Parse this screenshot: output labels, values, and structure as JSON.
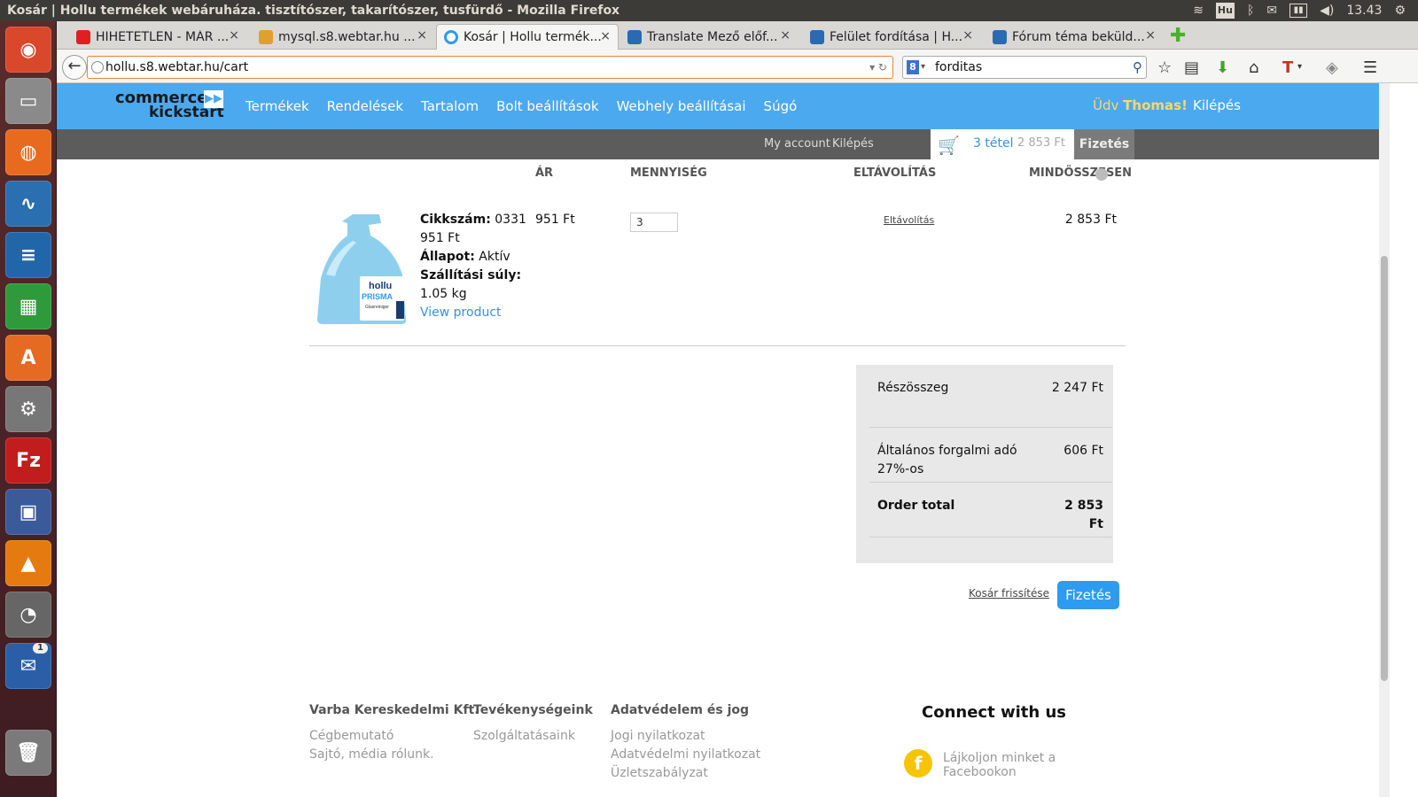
{
  "window": {
    "title": "Kosár | Hollu termékek webáruháza. tisztítószer, takarítószer, tusfürdő - Mozilla Firefox",
    "clock": "13.43",
    "keyboard": "Hu"
  },
  "tabs": [
    {
      "label": "HIHETETLEN - MÁR ...",
      "close": "×",
      "active": false,
      "fav_color": "#e02020"
    },
    {
      "label": "mysql.s8.webtar.hu ...",
      "close": "×",
      "active": false,
      "fav_color": "#e0a030"
    },
    {
      "label": "Kosár | Hollu termék...",
      "close": "×",
      "active": true,
      "fav_color": "#2d9bf0"
    },
    {
      "label": "Translate Mező előf...",
      "close": "×",
      "active": false,
      "fav_color": "#2a6ab0"
    },
    {
      "label": "Felület fordítása | H...",
      "close": "×",
      "active": false,
      "fav_color": "#2a6ab0"
    },
    {
      "label": "Fórum téma beküld...",
      "close": "×",
      "active": false,
      "fav_color": "#2a6ab0"
    }
  ],
  "navbar": {
    "url": "hollu.s8.webtar.hu/cart",
    "search_value": "forditas",
    "search_engine": "8"
  },
  "launcher": [
    {
      "name": "ubuntu-icon",
      "bg": "#d9482b",
      "glyph": "◉"
    },
    {
      "name": "files-icon",
      "bg": "#8a8a8a",
      "glyph": "▭"
    },
    {
      "name": "firefox-icon",
      "bg": "#e86a1f",
      "glyph": "◍"
    },
    {
      "name": "system-monitor-icon",
      "bg": "#2a6fb0",
      "glyph": "∿"
    },
    {
      "name": "writer-icon",
      "bg": "#2266aa",
      "glyph": "≡"
    },
    {
      "name": "calc-icon",
      "bg": "#2f9a3b",
      "glyph": "▦"
    },
    {
      "name": "software-center-icon",
      "bg": "#e56b22",
      "glyph": "A"
    },
    {
      "name": "settings-icon",
      "bg": "#777",
      "glyph": "⚙"
    },
    {
      "name": "filezilla-icon",
      "bg": "#c11d1d",
      "glyph": "Fz"
    },
    {
      "name": "screenshot-icon",
      "bg": "#3a5a9a",
      "glyph": "▣"
    },
    {
      "name": "vlc-icon",
      "bg": "#e57a10",
      "glyph": "▲"
    },
    {
      "name": "gimp-icon",
      "bg": "#666",
      "glyph": "◔"
    },
    {
      "name": "thunderbird-icon",
      "bg": "#2a5fa8",
      "glyph": "✉",
      "badge": "1"
    },
    {
      "name": "trash-icon",
      "bg": "#7a7a7a",
      "glyph": "🗑"
    }
  ],
  "site": {
    "logo_line1": "commerce",
    "logo_line2": "kickstart",
    "logo_arrow": "▶▶",
    "nav": [
      "Termékek",
      "Rendelések",
      "Tartalom",
      "Bolt beállítások",
      "Webhely beállításai",
      "Súgó"
    ],
    "greeting_prefix": "Üdv",
    "greeting_name": "Thomas!",
    "logout": "Kilépés",
    "my_account": "My account",
    "logout_small": "Kilépés",
    "cart_count": "3 tétel",
    "cart_amount": "2 853 Ft",
    "checkout_tab": "Fizetés"
  },
  "cart": {
    "headers": {
      "price": "ÁR",
      "quantity": "MENNYISÉG",
      "remove": "ELTÁVOLÍTÁS",
      "total": "MINDÖSSZESEN"
    },
    "item": {
      "sku_label": "Cikkszám:",
      "sku_value": "0331",
      "sku_price": "951 Ft",
      "status_label": "Állapot:",
      "status_value": "Aktív",
      "weight_label": "Szállítási súly:",
      "weight_value": "1.05 kg",
      "view_link": "View product",
      "price": "951 Ft",
      "quantity": "3",
      "remove": "Eltávolítás",
      "line_total": "2 853 Ft",
      "image_brand": "hollu",
      "image_product": "PRISMA",
      "image_sub": "Glasreiniger"
    },
    "summary": {
      "subtotal_label": "Részösszeg",
      "subtotal_value": "2 247 Ft",
      "vat_label": "Általános forgalmi adó 27%-os",
      "vat_value": "606 Ft",
      "total_label": "Order total",
      "total_value": "2 853 Ft"
    },
    "update_button": "Kosár frissítése",
    "checkout_button": "Fizetés"
  },
  "footer": {
    "col1": {
      "heading": "Varba Kereskedelmi Kft.",
      "links": [
        "Cégbemutató",
        "Sajtó, média rólunk."
      ]
    },
    "col2": {
      "heading": "Tevékenységeink",
      "links": [
        "Szolgáltatásaink"
      ]
    },
    "col3": {
      "heading": "Adatvédelem és jog",
      "links": [
        "Jogi nyilatkozat",
        "Adatvédelmi nyilatkozat",
        "Üzletszabályzat"
      ]
    },
    "connect_heading": "Connect with us",
    "facebook_text": "Lájkoljon minket a Facebookon",
    "facebook_glyph": "f"
  },
  "colors": {
    "header_blue": "#4ba9f0",
    "link_blue": "#3b8fd9",
    "button_blue": "#2d9bf0",
    "greeting_yellow": "#ffd66b"
  }
}
